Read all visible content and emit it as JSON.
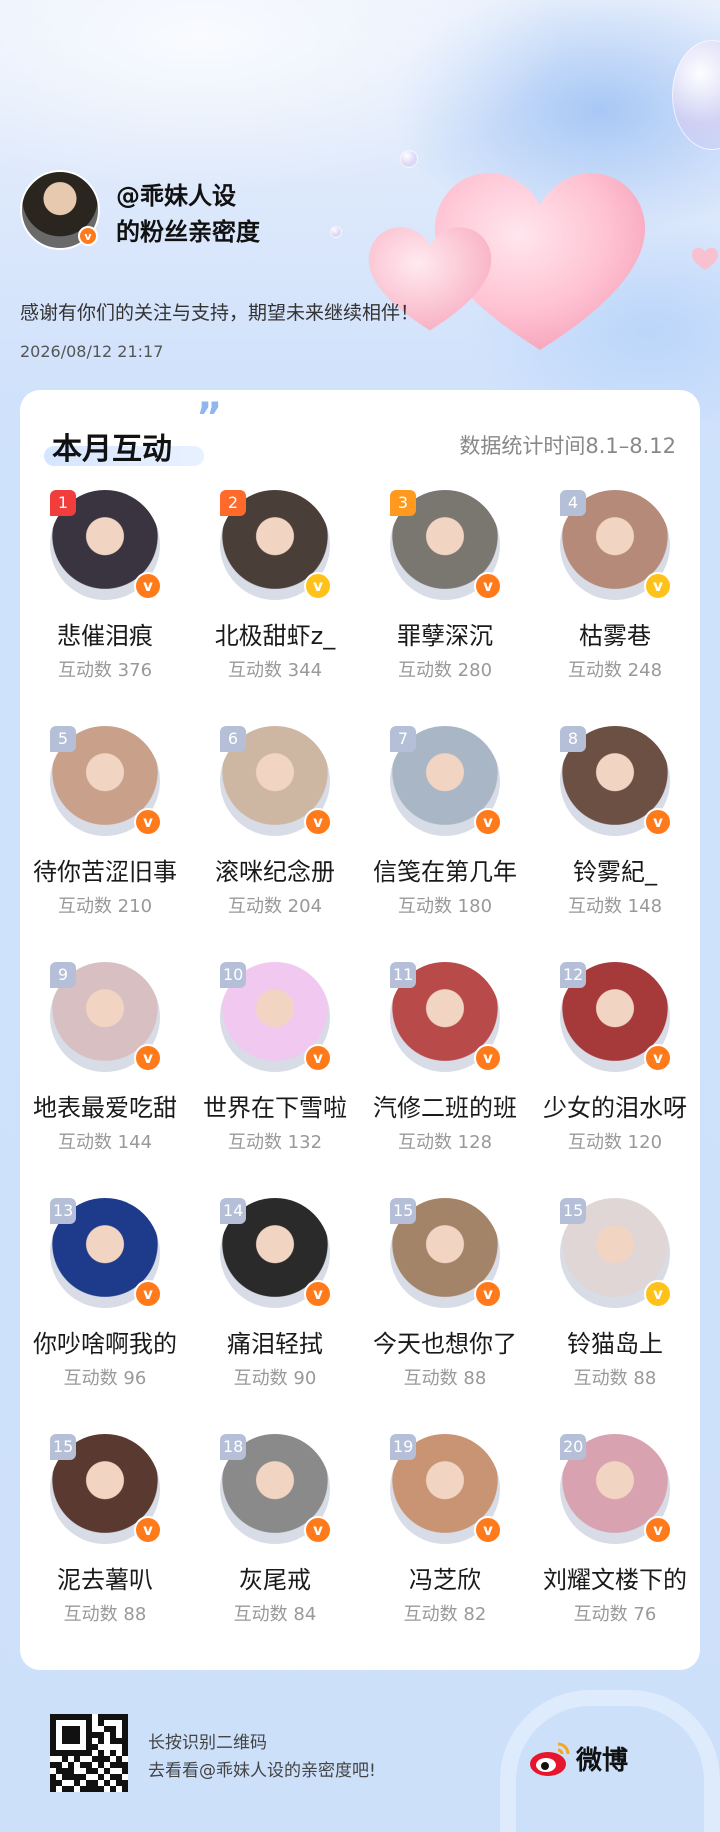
{
  "header": {
    "username": "@乖妹人设",
    "subtitle": "的粉丝亲密度",
    "thanks": "感谢有你们的关注与支持，期望未来继续相伴！",
    "datetime": "2026/08/12 21:17"
  },
  "card": {
    "title": "本月互动",
    "period": "数据统计时间8.1–8.12"
  },
  "fans": [
    {
      "rank": "1",
      "name": "悲催泪痕",
      "count": "互动数 376",
      "color": "#3a3440"
    },
    {
      "rank": "2",
      "name": "北极甜虾z_",
      "count": "互动数 344",
      "color": "#4a3e38"
    },
    {
      "rank": "3",
      "name": "罪孽深沉",
      "count": "互动数 280",
      "color": "#7a7670"
    },
    {
      "rank": "4",
      "name": "枯雾巷",
      "count": "互动数 248",
      "color": "#b58a78"
    },
    {
      "rank": "5",
      "name": "待你苦涩旧事",
      "count": "互动数 210",
      "color": "#c9a08a"
    },
    {
      "rank": "6",
      "name": "滚咪纪念册",
      "count": "互动数 204",
      "color": "#cdb7a3"
    },
    {
      "rank": "7",
      "name": "信笺在第几年",
      "count": "互动数 180",
      "color": "#a9b6c6"
    },
    {
      "rank": "8",
      "name": "铃雾紀_",
      "count": "互动数 148",
      "color": "#6c5044"
    },
    {
      "rank": "9",
      "name": "地表最爱吃甜",
      "count": "互动数 144",
      "color": "#d8c0c2"
    },
    {
      "rank": "10",
      "name": "世界在下雪啦",
      "count": "互动数 132",
      "color": "#f1c8ef"
    },
    {
      "rank": "11",
      "name": "汽修二班的班",
      "count": "互动数 128",
      "color": "#b94a4a"
    },
    {
      "rank": "12",
      "name": "少女的泪水呀",
      "count": "互动数 120",
      "color": "#a63a3a"
    },
    {
      "rank": "13",
      "name": "你吵啥啊我的",
      "count": "互动数 96",
      "color": "#1e3a8a"
    },
    {
      "rank": "14",
      "name": "痛泪轻拭",
      "count": "互动数 90",
      "color": "#2a2a2a"
    },
    {
      "rank": "15",
      "name": "今天也想你了",
      "count": "互动数 88",
      "color": "#a48468"
    },
    {
      "rank": "15",
      "name": "铃猫岛上",
      "count": "互动数 88",
      "color": "#e0d6d6"
    },
    {
      "rank": "15",
      "name": "泥去薯叭",
      "count": "互动数 88",
      "color": "#5a3a30"
    },
    {
      "rank": "18",
      "name": "灰尾戒",
      "count": "互动数 84",
      "color": "#8a8a8a"
    },
    {
      "rank": "19",
      "name": "冯芝欣",
      "count": "互动数 82",
      "color": "#c89474"
    },
    {
      "rank": "20",
      "name": "刘耀文楼下的",
      "count": "互动数 76",
      "color": "#d9a2b0"
    }
  ],
  "footer": {
    "scan_line1": "长按识别二维码",
    "scan_line2": "去看看@乖妹人设的亲密度吧!",
    "brand": "微博"
  },
  "colors": {
    "accent": "#ff7a1a",
    "rank1": "#f23d3d",
    "rank2": "#ff6a2b",
    "rank3": "#ff9a1f",
    "rank_default": "#b5c0d8"
  },
  "icons": {
    "verified": "verified-badge-icon",
    "qr": "qr-code-icon",
    "brand": "weibo-logo-icon"
  }
}
